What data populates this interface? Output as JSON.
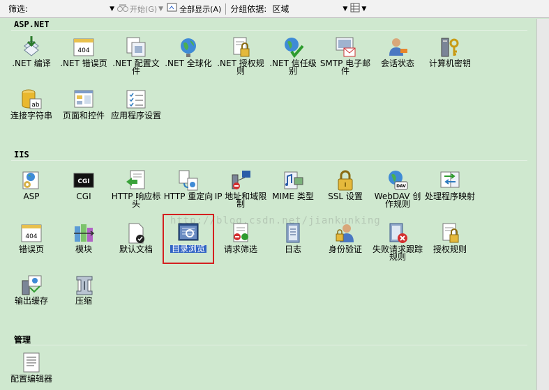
{
  "toolbar": {
    "filter_label": "筛选:",
    "start_label": "开始(G)",
    "show_all_label": "全部显示(A)",
    "group_by_label": "分组依据:",
    "group_by_value": "区域"
  },
  "sections": {
    "aspnet": {
      "title": "ASP.NET",
      "items": [
        {
          "label": ".NET 编译",
          "icon": "compile-icon"
        },
        {
          "label": ".NET 错误页",
          "icon": "error-page-icon"
        },
        {
          "label": ".NET 配置文件",
          "icon": "profile-icon"
        },
        {
          "label": ".NET 全球化",
          "icon": "globe-icon"
        },
        {
          "label": ".NET 授权规则",
          "icon": "auth-rules-icon"
        },
        {
          "label": ".NET 信任级别",
          "icon": "trust-icon"
        },
        {
          "label": "SMTP 电子邮件",
          "icon": "smtp-icon"
        },
        {
          "label": "会话状态",
          "icon": "session-icon"
        },
        {
          "label": "计算机密钥",
          "icon": "machine-key-icon"
        },
        {
          "label": "连接字符串",
          "icon": "connection-string-icon"
        },
        {
          "label": "页面和控件",
          "icon": "pages-controls-icon"
        },
        {
          "label": "应用程序设置",
          "icon": "app-settings-icon"
        }
      ]
    },
    "iis": {
      "title": "IIS",
      "items": [
        {
          "label": "ASP",
          "icon": "asp-icon"
        },
        {
          "label": "CGI",
          "icon": "cgi-icon"
        },
        {
          "label": "HTTP 响应标头",
          "icon": "http-headers-icon"
        },
        {
          "label": "HTTP 重定向",
          "icon": "redirect-icon"
        },
        {
          "label": "IP 地址和域限制",
          "icon": "ip-restrict-icon"
        },
        {
          "label": "MIME 类型",
          "icon": "mime-icon"
        },
        {
          "label": "SSL 设置",
          "icon": "ssl-lock-icon"
        },
        {
          "label": "WebDAV 创作规则",
          "icon": "webdav-icon"
        },
        {
          "label": "处理程序映射",
          "icon": "handler-mapping-icon"
        },
        {
          "label": "错误页",
          "icon": "error-page-icon"
        },
        {
          "label": "模块",
          "icon": "modules-icon"
        },
        {
          "label": "默认文档",
          "icon": "default-doc-icon"
        },
        {
          "label": "目录浏览",
          "icon": "directory-browse-icon"
        },
        {
          "label": "请求筛选",
          "icon": "request-filter-icon"
        },
        {
          "label": "日志",
          "icon": "logging-icon"
        },
        {
          "label": "身份验证",
          "icon": "authentication-icon"
        },
        {
          "label": "失败请求跟踪规则",
          "icon": "failed-trace-icon"
        },
        {
          "label": "授权规则",
          "icon": "authorization-icon"
        },
        {
          "label": "输出缓存",
          "icon": "output-cache-icon"
        },
        {
          "label": "压缩",
          "icon": "compression-icon"
        }
      ]
    },
    "management": {
      "title": "管理",
      "items": [
        {
          "label": "配置编辑器",
          "icon": "config-editor-icon"
        }
      ]
    }
  },
  "watermark": "http://blog.csdn.net/jiankunking"
}
